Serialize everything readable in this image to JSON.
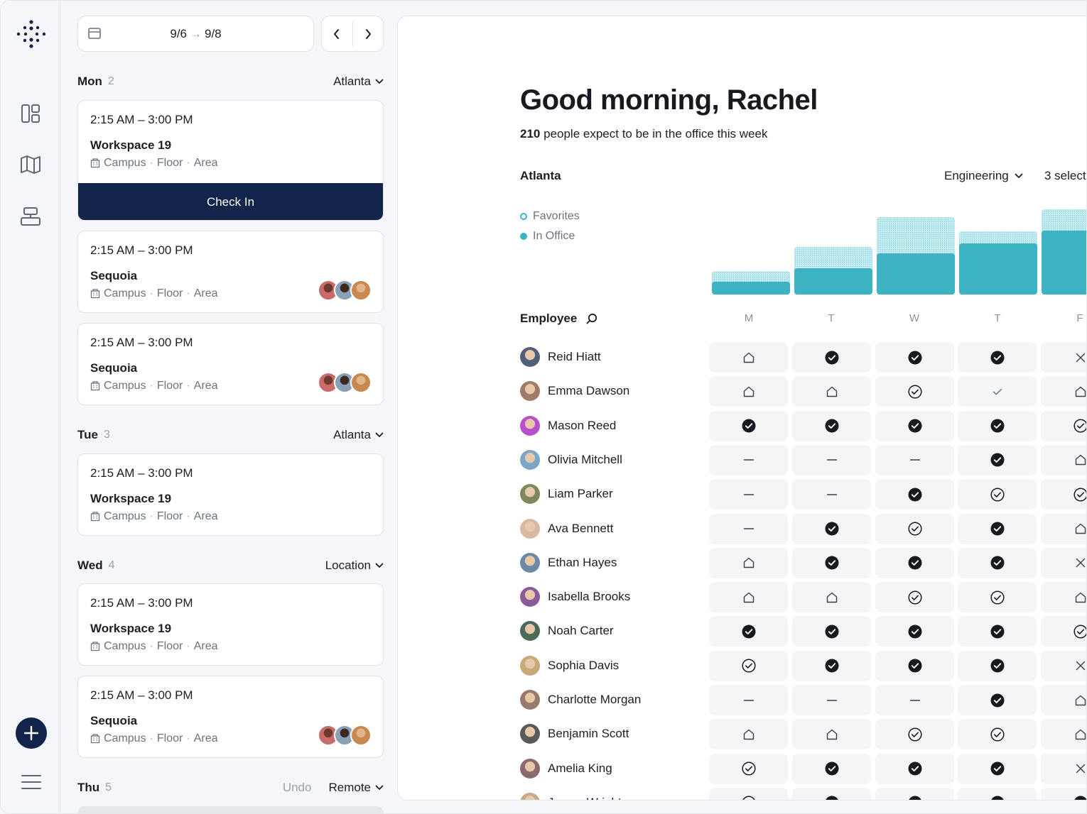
{
  "rail": {
    "icons": [
      "dashboard-icon",
      "map-icon",
      "desk-layout-icon"
    ],
    "add_icon": "plus-icon",
    "menu_icon": "hamburger-menu-icon"
  },
  "schedule": {
    "date_start": "9/6",
    "date_arrow": "→",
    "date_end": "9/8",
    "days": [
      {
        "name": "Mon",
        "count": "2",
        "location": "Atlanta"
      },
      {
        "name": "Tue",
        "count": "3",
        "location": "Atlanta"
      },
      {
        "name": "Wed",
        "count": "4",
        "location": "Location"
      },
      {
        "name": "Thu",
        "count": "5",
        "location": "Remote",
        "undo": "Undo"
      }
    ],
    "bookings": [
      {
        "time": "2:15 AM – 3:00 PM",
        "space": "Workspace 19",
        "campus": "Campus",
        "floor": "Floor",
        "area": "Area",
        "action": "Check In"
      },
      {
        "time": "2:15 AM – 3:00 PM",
        "space": "Sequoia",
        "campus": "Campus",
        "floor": "Floor",
        "area": "Area"
      },
      {
        "time": "2:15 AM – 3:00 PM",
        "space": "Sequoia",
        "campus": "Campus",
        "floor": "Floor",
        "area": "Area"
      },
      {
        "time": "2:15 AM – 3:00 PM",
        "space": "Workspace 19",
        "campus": "Campus",
        "floor": "Floor",
        "area": "Area"
      },
      {
        "time": "2:15 AM – 3:00 PM",
        "space": "Workspace 19",
        "campus": "Campus",
        "floor": "Floor",
        "area": "Area"
      },
      {
        "time": "2:15 AM – 3:00 PM",
        "space": "Sequoia",
        "campus": "Campus",
        "floor": "Floor",
        "area": "Area"
      }
    ],
    "separator": "·"
  },
  "main": {
    "greeting": "Good morning, Rachel",
    "expected_count": "210",
    "expected_text": "people expect to be in the office this week",
    "office": "Atlanta",
    "department": "Engineering",
    "selection": "3 select",
    "legend": {
      "favorites": "Favorites",
      "in_office": "In Office"
    },
    "employee_header": "Employee",
    "day_letters": [
      "M",
      "T",
      "W",
      "T",
      "F"
    ],
    "employees": [
      {
        "name": "Reid Hiatt",
        "status": [
          "home",
          "check",
          "check",
          "check",
          "x"
        ]
      },
      {
        "name": "Emma Dawson",
        "status": [
          "home",
          "home",
          "check-outline",
          "tick",
          "home"
        ]
      },
      {
        "name": "Mason Reed",
        "status": [
          "check",
          "check",
          "check",
          "check",
          "check-outline"
        ]
      },
      {
        "name": "Olivia Mitchell",
        "status": [
          "dash",
          "dash",
          "dash",
          "check",
          "home"
        ]
      },
      {
        "name": "Liam Parker",
        "status": [
          "dash",
          "dash",
          "check",
          "check-outline",
          "check-outline"
        ]
      },
      {
        "name": "Ava Bennett",
        "status": [
          "dash",
          "check",
          "check-outline",
          "check",
          "home"
        ]
      },
      {
        "name": "Ethan Hayes",
        "status": [
          "home",
          "check",
          "check",
          "check",
          "x"
        ]
      },
      {
        "name": "Isabella Brooks",
        "status": [
          "home",
          "home",
          "check-outline",
          "check-outline",
          "home"
        ]
      },
      {
        "name": "Noah Carter",
        "status": [
          "check",
          "check",
          "check",
          "check",
          "check-outline"
        ]
      },
      {
        "name": "Sophia Davis",
        "status": [
          "check-outline",
          "check",
          "check",
          "check",
          "x"
        ]
      },
      {
        "name": "Charlotte Morgan",
        "status": [
          "dash",
          "dash",
          "dash",
          "check",
          "home"
        ]
      },
      {
        "name": "Benjamin Scott",
        "status": [
          "home",
          "home",
          "check-outline",
          "check-outline",
          "home"
        ]
      },
      {
        "name": "Amelia King",
        "status": [
          "check-outline",
          "check",
          "check",
          "check",
          "x"
        ]
      },
      {
        "name": "James Wright",
        "status": [
          "check-outline",
          "check",
          "check",
          "check",
          "check"
        ]
      }
    ]
  },
  "colors": {
    "accent": "#3db2c2",
    "navy": "#13244b"
  }
}
